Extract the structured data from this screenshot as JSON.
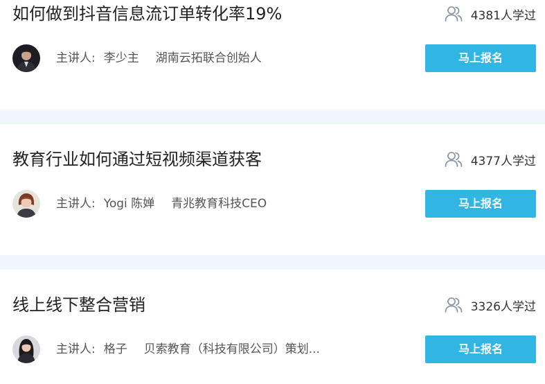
{
  "accent_color": "#31b5e2",
  "separator_color": "#eef7fc",
  "courses": [
    {
      "title": "如何做到抖音信息流订单转化率19%",
      "learners": "4381人学过",
      "speaker_label": "主讲人:",
      "speaker_name": "李少主",
      "speaker_title": "湖南云拓联合创始人",
      "button_label": "马上报名"
    },
    {
      "title": "教育行业如何通过短视频渠道获客",
      "learners": "4377人学过",
      "speaker_label": "主讲人:",
      "speaker_name": "Yogi 陈婵",
      "speaker_title": "青兆教育科技CEO",
      "button_label": "马上报名"
    },
    {
      "title": "线上线下整合营销",
      "learners": "3326人学过",
      "speaker_label": "主讲人:",
      "speaker_name": "格子",
      "speaker_title": "贝索教育（科技有限公司）策划...",
      "button_label": "马上报名"
    }
  ]
}
